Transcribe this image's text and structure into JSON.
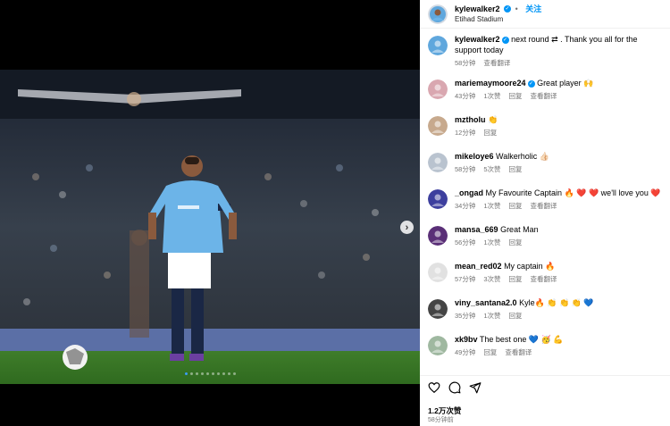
{
  "post": {
    "author": "kylewalker2",
    "follow_label": "关注",
    "location": "Etihad Stadium",
    "dot_separator": "•",
    "next_arrow": "›",
    "carousel_count": 10,
    "carousel_active": 0
  },
  "comments": [
    {
      "user": "kylewalker2",
      "verified": true,
      "text": "next round ⇄ . Thank you all for the support today",
      "time": "58分钟",
      "likes": "",
      "reply": "",
      "translate": "查看翻译"
    },
    {
      "user": "mariemaymoore24",
      "verified": true,
      "text": "Great player 🙌",
      "time": "43分钟",
      "likes": "1次赞",
      "reply": "回复",
      "translate": "查看翻译"
    },
    {
      "user": "mztholu",
      "verified": false,
      "text": "👏",
      "time": "12分钟",
      "likes": "",
      "reply": "回复",
      "translate": ""
    },
    {
      "user": "mikeloye6",
      "verified": false,
      "text": "Walkerholic 👍🏻",
      "time": "58分钟",
      "likes": "5次赞",
      "reply": "回复",
      "translate": ""
    },
    {
      "user": "_ongad",
      "verified": false,
      "text": "My Favourite Captain 🔥 ❤️ ❤️ we'll love you ❤️",
      "time": "34分钟",
      "likes": "1次赞",
      "reply": "回复",
      "translate": "查看翻译"
    },
    {
      "user": "mansa_669",
      "verified": false,
      "text": "Great Man",
      "time": "56分钟",
      "likes": "1次赞",
      "reply": "回复",
      "translate": ""
    },
    {
      "user": "mean_red02",
      "verified": false,
      "text": "My captain 🔥",
      "time": "57分钟",
      "likes": "3次赞",
      "reply": "回复",
      "translate": "查看翻译"
    },
    {
      "user": "viny_santana2.0",
      "verified": false,
      "text": "Kyle🔥 👏 👏 👏 💙",
      "time": "35分钟",
      "likes": "1次赞",
      "reply": "回复",
      "translate": ""
    },
    {
      "user": "xk9bv",
      "verified": false,
      "text": "The best one 💙 🥳 💪",
      "time": "49分钟",
      "likes": "",
      "reply": "回复",
      "translate": "查看翻译"
    }
  ],
  "footer": {
    "likes": "1.2万次赞",
    "posted": "58分钟前"
  },
  "icons": [
    "heart-icon",
    "comment-icon",
    "share-icon"
  ],
  "colors": {
    "accent": "#0095f6",
    "sky_blue": "#6cb4e8"
  }
}
